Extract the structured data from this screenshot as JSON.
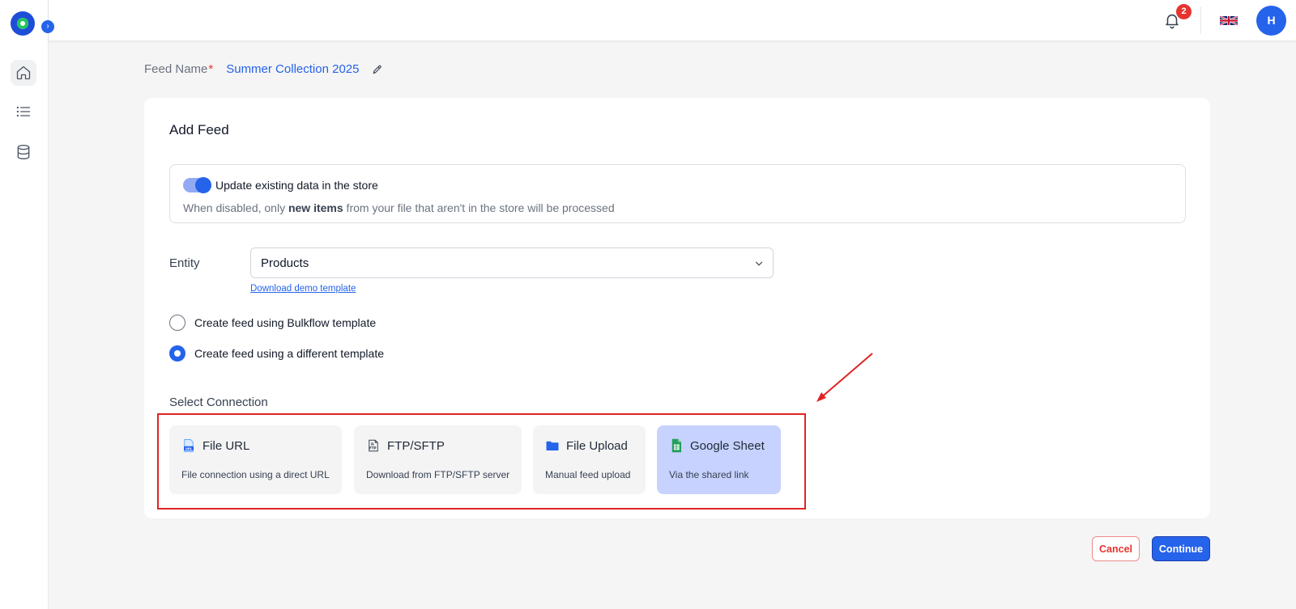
{
  "header": {
    "notification_count": "2",
    "language_flag": "uk-flag-icon",
    "avatar_initial": "H"
  },
  "sidebar": {
    "items": [
      {
        "icon": "home-icon"
      },
      {
        "icon": "list-icon"
      },
      {
        "icon": "database-icon"
      }
    ]
  },
  "feed": {
    "name_label": "Feed Name",
    "required_mark": "*",
    "name_value": "Summer Collection 2025"
  },
  "card": {
    "title": "Add Feed",
    "update_toggle": {
      "label": "Update existing data in the store",
      "enabled": true,
      "desc_prefix": "When disabled, only ",
      "desc_bold": "new items",
      "desc_suffix": " from your file that aren't in the store will be processed"
    },
    "entity": {
      "label": "Entity",
      "value": "Products",
      "demo_link": "Download demo template"
    },
    "radios": [
      {
        "label": "Create feed using Bulkflow template",
        "checked": false
      },
      {
        "label": "Create feed using a different template",
        "checked": true
      }
    ],
    "select_connection": "Select Connection",
    "connections": [
      {
        "title": "File URL",
        "desc": "File connection using a direct URL",
        "icon": "url-file-icon",
        "active": false
      },
      {
        "title": "FTP/SFTP",
        "desc": "Download from FTP/SFTP server",
        "icon": "ftp-file-icon",
        "active": false
      },
      {
        "title": "File Upload",
        "desc": "Manual feed upload",
        "icon": "folder-icon",
        "active": false
      },
      {
        "title": "Google Sheet",
        "desc": "Via the shared link",
        "icon": "google-sheet-icon",
        "active": true
      }
    ]
  },
  "actions": {
    "cancel": "Cancel",
    "continue": "Continue"
  },
  "colors": {
    "accent": "#2563eb",
    "danger": "#e5342f",
    "selected_card": "#c7d2fe"
  }
}
